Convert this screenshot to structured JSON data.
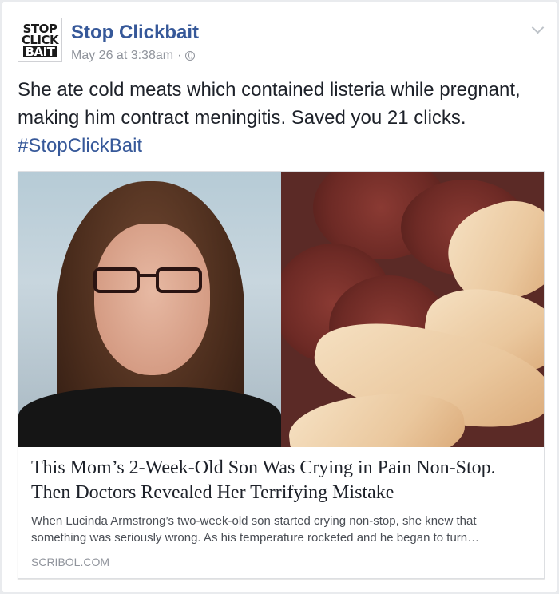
{
  "page": {
    "name": "Stop Clickbait",
    "logo_text": [
      "STOP",
      "CLICK",
      "BAIT"
    ],
    "timestamp": "May 26 at 3:38am",
    "separator": "·",
    "privacy_icon": "globe-icon",
    "menu_icon": "chevron-down-icon"
  },
  "post": {
    "text": "She ate cold meats which contained listeria while pregnant, making him contract meningitis. Saved you 21 clicks.",
    "hashtag": "#StopClickBait"
  },
  "link_card": {
    "title": "This Mom’s 2-Week-Old Son Was Crying in Pain Non-Stop. Then Doctors Revealed Her Terrifying Mistake",
    "description_line1": "When Lucinda Armstrong’s two-week-old son started crying non-stop, she knew that",
    "description_line2": "something was seriously wrong. As his temperature rocketed and he began to turn…",
    "domain": "SCRIBOL.COM"
  },
  "colors": {
    "link_blue": "#365899",
    "meta_gray": "#90949c",
    "text": "#1d2129",
    "background": "#e9ebee"
  }
}
